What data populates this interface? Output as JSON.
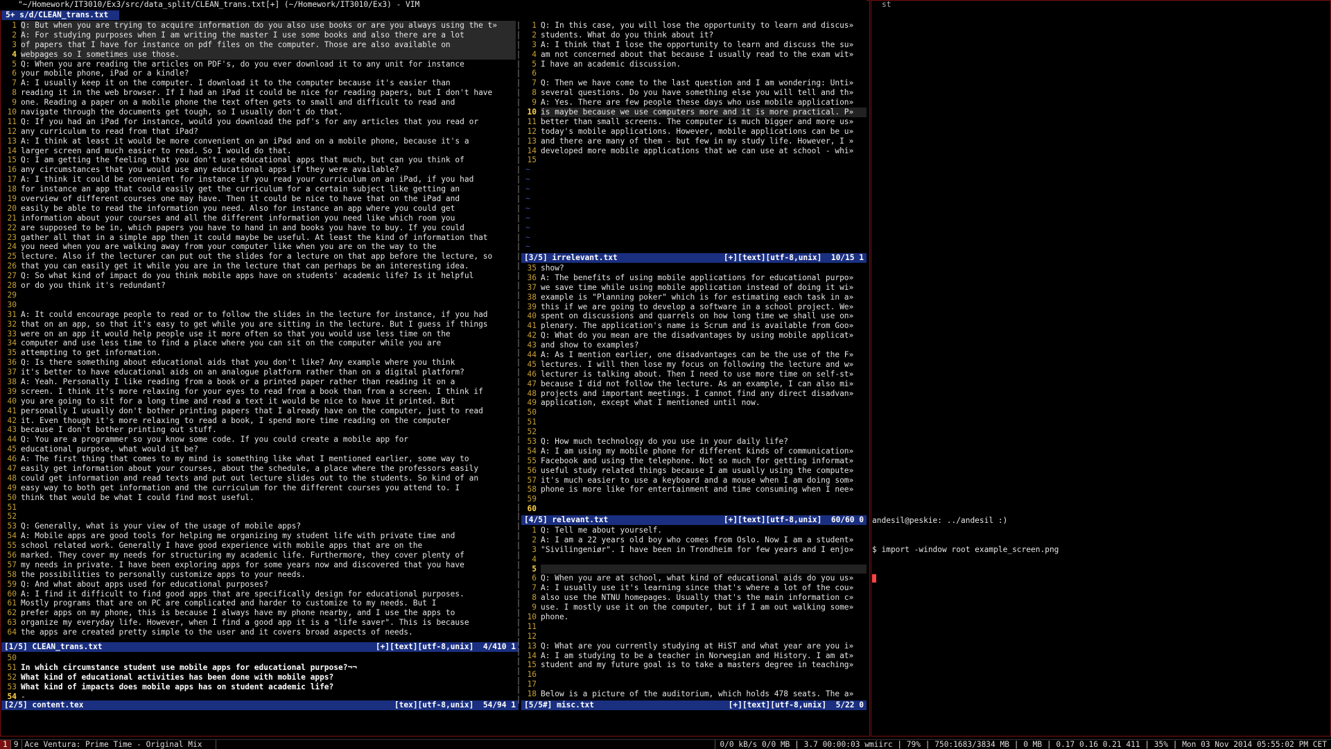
{
  "window_title": "\"~/Homework/IT3010/Ex3/src/data_split/CLEAN_trans.txt[+] (~/Homework/IT3010/Ex3) - VIM",
  "st_title": "st",
  "tabline": "5+ s/d/CLEAN_trans.txt",
  "pane1": {
    "lines": [
      {
        "n": "1",
        "t": "Q: But when you are trying to acquire information do you also use books or are you always using the t»",
        "sel": true
      },
      {
        "n": "2",
        "t": "A: For studying purposes when I am writing the master I use some books and also there are a lot",
        "sel": true
      },
      {
        "n": "3",
        "t": "of papers that I have for instance on pdf files on the computer. Those are also available on",
        "sel": true
      },
      {
        "n": "4",
        "t": "webpages so I sometimes use those.",
        "sel": true,
        "cur": true
      },
      {
        "n": "5",
        "t": "Q: When you are reading the articles on PDF's, do you ever download it to any unit for instance"
      },
      {
        "n": "6",
        "t": "your mobile phone, iPad or a kindle?"
      },
      {
        "n": "7",
        "t": "A: I usually keep it on the computer. I download it to the computer because it's easier than"
      },
      {
        "n": "8",
        "t": "reading it in the web browser. If I had an iPad it could be nice for reading papers, but I don't have"
      },
      {
        "n": "9",
        "t": "one. Reading a paper on a mobile phone the text often gets to small and difficult to read and"
      },
      {
        "n": "10",
        "t": "navigate through the documents get tough, so I usually don't do that."
      },
      {
        "n": "11",
        "t": "Q: If you had an iPad for instance, would you download the pdf's for any articles that you read or"
      },
      {
        "n": "12",
        "t": "any curriculum to read from that iPad?"
      },
      {
        "n": "13",
        "t": "A: I think at least it would be more convenient on an iPad and on a mobile phone, because it's a"
      },
      {
        "n": "14",
        "t": "larger screen and much easier to read. So I would do that."
      },
      {
        "n": "15",
        "t": "Q: I am getting the feeling that you don't use educational apps that much, but can you think of"
      },
      {
        "n": "16",
        "t": "any circumstances that you would use any educational apps if they were available?"
      },
      {
        "n": "17",
        "t": "A: I think it could be convenient for instance if you read your curriculum on an iPad, if you had"
      },
      {
        "n": "18",
        "t": "for instance an app that could easily get the curriculum for a certain subject like getting an"
      },
      {
        "n": "19",
        "t": "overview of different courses one may have. Then it could be nice to have that on the iPad and"
      },
      {
        "n": "20",
        "t": "easily be able to read the information you need. Also for instance an app where you could get"
      },
      {
        "n": "21",
        "t": "information about your courses and all the different information you need like which room you"
      },
      {
        "n": "22",
        "t": "are supposed to be in, which papers you have to hand in and books you have to buy. If you could"
      },
      {
        "n": "23",
        "t": "gather all that in a simple app then it could maybe be useful. At least the kind of information that"
      },
      {
        "n": "24",
        "t": "you need when you are walking away from your computer like when you are on the way to the"
      },
      {
        "n": "25",
        "t": "lecture. Also if the lecturer can put out the slides for a lecture on that app before the lecture, so"
      },
      {
        "n": "26",
        "t": "that you can easily get it while you are in the lecture that can perhaps be an interesting idea."
      },
      {
        "n": "27",
        "t": "Q: So what kind of impact do you think mobile apps have on students' academic life? Is it helpful"
      },
      {
        "n": "28",
        "t": "or do you think it's redundant?"
      },
      {
        "n": "29",
        "t": ""
      },
      {
        "n": "30",
        "t": ""
      },
      {
        "n": "31",
        "t": "A: It could encourage people to read or to follow the slides in the lecture for instance, if you had"
      },
      {
        "n": "32",
        "t": "that on an app, so that it's easy to get while you are sitting in the lecture. But I guess if things"
      },
      {
        "n": "33",
        "t": "were on an app it would help people use it more often so that you would use less time on the"
      },
      {
        "n": "34",
        "t": "computer and use less time to find a place where you can sit on the computer while you are"
      },
      {
        "n": "35",
        "t": "attempting to get information."
      },
      {
        "n": "36",
        "t": "Q: Is there something about educational aids that you don't like? Any example where you think"
      },
      {
        "n": "37",
        "t": "it's better to have educational aids on an analogue platform rather than on a digital platform?"
      },
      {
        "n": "38",
        "t": "A: Yeah. Personally I like reading from a book or a printed paper rather than reading it on a"
      },
      {
        "n": "39",
        "t": "screen. I think it's more relaxing for your eyes to read from a book than from a screen. I think if"
      },
      {
        "n": "40",
        "t": "you are going to sit for a long time and read a text it would be nice to have it printed. But"
      },
      {
        "n": "41",
        "t": "personally I usually don't bother printing papers that I already have on the computer, just to read"
      },
      {
        "n": "42",
        "t": "it. Even though it's more relaxing to read a book, I spend more time reading on the computer"
      },
      {
        "n": "43",
        "t": "because I don't bother printing out stuff."
      },
      {
        "n": "44",
        "t": "Q: You are a programmer so you know some code. If you could create a mobile app for"
      },
      {
        "n": "45",
        "t": "educational purpose, what would it be?"
      },
      {
        "n": "46",
        "t": "A: The first thing that comes to my mind is something like what I mentioned earlier, some way to"
      },
      {
        "n": "47",
        "t": "easily get information about your courses, about the schedule, a place where the professors easily"
      },
      {
        "n": "48",
        "t": "could get information and read texts and put out lecture slides out to the students. So kind of an"
      },
      {
        "n": "49",
        "t": "easy way to both get information and the curriculum for the different courses you attend to. I"
      },
      {
        "n": "50",
        "t": "think that would be what I could find most useful."
      },
      {
        "n": "51",
        "t": ""
      },
      {
        "n": "52",
        "t": ""
      },
      {
        "n": "53",
        "t": "Q: Generally, what is your view of the usage of mobile apps?"
      },
      {
        "n": "54",
        "t": "A: Mobile apps are good tools for helping me organizing my student life with private time and"
      },
      {
        "n": "55",
        "t": "school related work. Generally I have good experience with mobile apps that are on the"
      },
      {
        "n": "56",
        "t": "marked. They cover my needs for structuring my academic life. Furthermore, they cover plenty of"
      },
      {
        "n": "57",
        "t": "my needs in private. I have been exploring apps for some years now and discovered that you have"
      },
      {
        "n": "58",
        "t": "the possibilities to personally customize apps to your needs."
      },
      {
        "n": "59",
        "t": "Q: And what about apps used for educational purposes?"
      },
      {
        "n": "60",
        "t": "A: I find it difficult to find good apps that are specifically design for educational purposes."
      },
      {
        "n": "61",
        "t": "Mostly programs that are on PC are complicated and harder to customize to my needs. But I"
      },
      {
        "n": "62",
        "t": "prefer apps on my phone, this is because I always have my phone nearby, and I use the apps to"
      },
      {
        "n": "63",
        "t": "organize my everyday life. However, when I find a good app it is a \"life saver\". This is because"
      },
      {
        "n": "64",
        "t": "the apps are created pretty simple to the user and it covers broad aspects of needs."
      }
    ],
    "status_left": "[1/5] CLEAN_trans.txt",
    "status_right": "[+][text][utf-8,unix]  4/410 1"
  },
  "pane2": {
    "lines": [
      {
        "n": "50",
        "t": ""
      },
      {
        "n": "51",
        "t": "In which circumstance student use mobile apps for educational purpose?¬¬",
        "bold": true
      },
      {
        "n": "52",
        "t": "What kind of educational activities has been done with mobile apps?",
        "bold": true
      },
      {
        "n": "53",
        "t": "What kind of impacts does mobile apps has on student academic life?",
        "bold": true
      },
      {
        "n": "54",
        "t": "-",
        "cur": true
      }
    ],
    "status_left": "[2/5] content.tex",
    "status_right": "[tex][utf-8,unix]  54/94 1"
  },
  "pane3": {
    "lines": [
      {
        "n": "1",
        "t": "Q: In this case, you will lose the opportunity to learn and discus»"
      },
      {
        "n": "2",
        "t": "students. What do you think about it?"
      },
      {
        "n": "3",
        "t": "A: I think that I lose the opportunity to learn and discuss the su»"
      },
      {
        "n": "4",
        "t": "am not concerned about that because I usually read to the exam wit»"
      },
      {
        "n": "5",
        "t": "I have an academic discussion."
      },
      {
        "n": "6",
        "t": ""
      },
      {
        "n": "7",
        "t": "Q: Then we have come to the last question and I am wondering: Unti»"
      },
      {
        "n": "8",
        "t": "several questions. Do you have something else you will tell and th»"
      },
      {
        "n": "9",
        "t": "A: Yes. There are few people these days who use mobile application»"
      },
      {
        "n": "10",
        "t": "is maybe because we use computers more and it is more practical. P»",
        "curline": true,
        "cur": true
      },
      {
        "n": "11",
        "t": "better than small screens. The computer is much bigger and more us»"
      },
      {
        "n": "12",
        "t": "today's mobile applications. However, mobile applications can be u»"
      },
      {
        "n": "13",
        "t": "and there are many of them - but few in my study life. However, I »"
      },
      {
        "n": "14",
        "t": "developed more mobile applications that we can use at school - whi»"
      },
      {
        "n": "15",
        "t": ""
      }
    ],
    "tildes": 9,
    "status_left": "[3/5] irrelevant.txt",
    "status_right": "[+][text][utf-8,unix]  10/15 1"
  },
  "pane4": {
    "lines": [
      {
        "n": "35",
        "t": "show?"
      },
      {
        "n": "36",
        "t": "A: The benefits of using mobile applications for educational purpo»"
      },
      {
        "n": "37",
        "t": "we save time while using mobile application instead of doing it wi»"
      },
      {
        "n": "38",
        "t": "example is \"Planning poker\" which is for estimating each task in a»"
      },
      {
        "n": "39",
        "t": "this if we are going to develop a software in a school project. We»"
      },
      {
        "n": "40",
        "t": "spent on discussions and quarrels on how long time we shall use on»"
      },
      {
        "n": "41",
        "t": "plenary. The application's name is Scrum and is available from Goo»"
      },
      {
        "n": "42",
        "t": "Q: What do you mean are the disadvantages by using mobile applicat»"
      },
      {
        "n": "43",
        "t": "and show to examples?"
      },
      {
        "n": "44",
        "t": "A: As I mention earlier, one disadvantages can be the use of the F»"
      },
      {
        "n": "45",
        "t": "lectures. I will then lose my focus on following the lecture and w»"
      },
      {
        "n": "46",
        "t": "lecturer is talking about. Then I need to use more time on self-st»"
      },
      {
        "n": "47",
        "t": "because I did not follow the lecture. As an example, I can also mi»"
      },
      {
        "n": "48",
        "t": "projects and important meetings. I cannot find any direct disadvan»"
      },
      {
        "n": "49",
        "t": "application, except what I mentioned until now."
      },
      {
        "n": "50",
        "t": ""
      },
      {
        "n": "51",
        "t": ""
      },
      {
        "n": "52",
        "t": ""
      },
      {
        "n": "53",
        "t": "Q: How much technology do you use in your daily life?"
      },
      {
        "n": "54",
        "t": "A: I am using my mobile phone for different kinds of communication»"
      },
      {
        "n": "55",
        "t": "Facebook and using the telephone. Not so much for getting informat»"
      },
      {
        "n": "56",
        "t": "useful study related things because I am usually using the compute»"
      },
      {
        "n": "57",
        "t": "it's much easier to use a keyboard and a mouse when I am doing som»"
      },
      {
        "n": "58",
        "t": "phone is more like for entertainment and time consuming when I nee»"
      },
      {
        "n": "59",
        "t": ""
      },
      {
        "n": "60",
        "t": "",
        "cur": true
      }
    ],
    "status_left": "[4/5] relevant.txt",
    "status_right": "[+][text][utf-8,unix]  60/60 0"
  },
  "pane5": {
    "lines": [
      {
        "n": "1",
        "t": "Q: Tell me about yourself."
      },
      {
        "n": "2",
        "t": "A: I am a 22 years old boy who comes from Oslo. Now I am a student»"
      },
      {
        "n": "3",
        "t": "\"Sivilingeniør\". I have been in Trondheim for few years and I enjo»"
      },
      {
        "n": "4",
        "t": ""
      },
      {
        "n": "5",
        "t": "",
        "curline": true,
        "cur": true
      },
      {
        "n": "6",
        "t": "Q: When you are at school, what kind of educational aids do you us»"
      },
      {
        "n": "7",
        "t": "A: I usually use it's learning since that's where a lot of the cou»"
      },
      {
        "n": "8",
        "t": "also use the NTNU homepages. Usually that's the main information c»"
      },
      {
        "n": "9",
        "t": "use. I mostly use it on the computer, but if I am out walking some»"
      },
      {
        "n": "10",
        "t": "phone."
      },
      {
        "n": "11",
        "t": ""
      },
      {
        "n": "12",
        "t": ""
      },
      {
        "n": "13",
        "t": "Q: What are you currently studying at HiST and what year are you i»"
      },
      {
        "n": "14",
        "t": "A: I am studying to be a teacher in Norwegian and History. I am at»"
      },
      {
        "n": "15",
        "t": "student and my future goal is to take a masters degree in teaching»"
      },
      {
        "n": "16",
        "t": ""
      },
      {
        "n": "17",
        "t": ""
      },
      {
        "n": "18",
        "t": "Below is a picture of the auditorium, which holds 478 seats. The a»"
      }
    ],
    "status_left": "[5/5#] misc.txt",
    "status_right": "[+][text][utf-8,unix]  5/22 0"
  },
  "terminal": {
    "prompt_line": "andesil@peskie: ../andesil :)",
    "command_line": "$ import -window root example_screen.png"
  },
  "bottombar": {
    "tags": [
      "1",
      "9"
    ],
    "active_tag": "1",
    "window_title": "Ace Ventura: Prime Time - Original Mix",
    "status": "0/0 kB/s 0/0 MB | 3.7 00:00:03 wmiirc | 79% | 750:1683/3834 MB | 0 MB | 0.17 0.16 0.21 411 | 35% | Mon 03 Nov 2014 05:55:02 PM CET"
  },
  "colors": {
    "statusline_bg": "#1a2f80",
    "line_number": "#c8a032",
    "border": "#7a1010",
    "tilde": "#3355bb",
    "cursor": "#ff4444"
  }
}
